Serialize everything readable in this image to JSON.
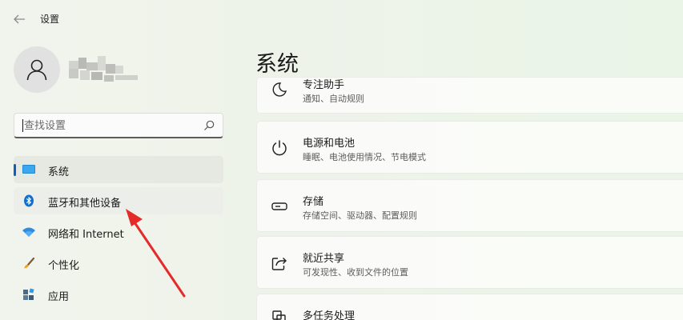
{
  "window": {
    "title": "设置",
    "back_icon": "back-arrow-icon"
  },
  "user": {
    "avatar_icon": "person-icon"
  },
  "search": {
    "placeholder": "查找设置",
    "value": "",
    "icon": "search-icon"
  },
  "nav": {
    "items": [
      {
        "label": "系统",
        "icon": "monitor-icon",
        "selected": true
      },
      {
        "label": "蓝牙和其他设备",
        "icon": "bluetooth-icon",
        "selected": false
      },
      {
        "label": "网络和 Internet",
        "icon": "wifi-icon",
        "selected": false
      },
      {
        "label": "个性化",
        "icon": "brush-icon",
        "selected": false
      },
      {
        "label": "应用",
        "icon": "apps-icon",
        "selected": false
      }
    ]
  },
  "main": {
    "title": "系统",
    "cards": [
      {
        "title": "专注助手",
        "subtitle": "通知、自动规则",
        "icon": "moon-icon"
      },
      {
        "title": "电源和电池",
        "subtitle": "睡眠、电池使用情况、节电模式",
        "icon": "power-icon"
      },
      {
        "title": "存储",
        "subtitle": "存储空间、驱动器、配置规则",
        "icon": "storage-icon"
      },
      {
        "title": "就近共享",
        "subtitle": "可发现性、收到文件的位置",
        "icon": "share-icon"
      },
      {
        "title": "多任务处理",
        "subtitle": "",
        "icon": "multitask-icon"
      }
    ]
  },
  "colors": {
    "accent": "#0a5fc4",
    "annotation_arrow": "#e52a2a"
  }
}
